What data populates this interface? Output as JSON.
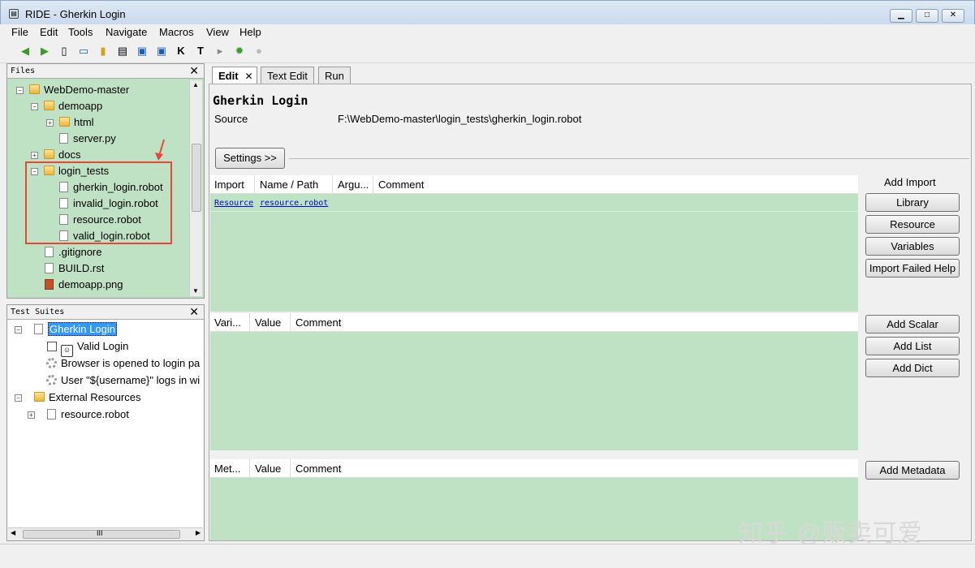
{
  "window": {
    "title": "RIDE - Gherkin Login",
    "icon": "ride-app-icon"
  },
  "menu": [
    "File",
    "Edit",
    "Tools",
    "Navigate",
    "Macros",
    "View",
    "Help"
  ],
  "files_panel": {
    "title": "Files",
    "tree": [
      {
        "label": "WebDemo-master",
        "type": "folder"
      },
      {
        "label": "demoapp",
        "type": "folder"
      },
      {
        "label": "html",
        "type": "folder"
      },
      {
        "label": "server.py",
        "type": "file"
      },
      {
        "label": "docs",
        "type": "folder"
      },
      {
        "label": "login_tests",
        "type": "folder"
      },
      {
        "label": "gherkin_login.robot",
        "type": "file"
      },
      {
        "label": "invalid_login.robot",
        "type": "file"
      },
      {
        "label": "resource.robot",
        "type": "file"
      },
      {
        "label": "valid_login.robot",
        "type": "file"
      },
      {
        "label": ".gitignore",
        "type": "file"
      },
      {
        "label": "BUILD.rst",
        "type": "file"
      },
      {
        "label": "demoapp.png",
        "type": "image"
      }
    ]
  },
  "suites_panel": {
    "title": "Test Suites",
    "items": [
      {
        "label": "Gherkin Login",
        "selected": true
      },
      {
        "label": "Valid Login"
      },
      {
        "label": "Browser is opened to login pa"
      },
      {
        "label": "User \"${username}\" logs in wi"
      },
      {
        "label": "External Resources"
      },
      {
        "label": "resource.robot"
      }
    ],
    "hscroll_mark": "III"
  },
  "tabs": [
    "Edit",
    "Text Edit",
    "Run"
  ],
  "editor": {
    "suite_title": "Gherkin Login",
    "source_label": "Source",
    "source_path": "F:\\WebDemo-master\\login_tests\\gherkin_login.robot",
    "settings_button": "Settings >>",
    "import_table": {
      "headers": [
        "Import",
        "Name / Path",
        "Argu...",
        "Comment"
      ],
      "rows": [
        [
          "Resource",
          "resource.robot",
          "",
          ""
        ]
      ]
    },
    "import_buttons": {
      "title": "Add Import",
      "library": "Library",
      "resource": "Resource",
      "variables": "Variables",
      "failed_help": "Import Failed Help"
    },
    "variable_table": {
      "headers": [
        "Vari...",
        "Value",
        "Comment"
      ]
    },
    "variable_buttons": {
      "scalar": "Add Scalar",
      "list": "Add List",
      "dict": "Add Dict"
    },
    "metadata_table": {
      "headers": [
        "Met...",
        "Value",
        "Comment"
      ]
    },
    "metadata_button": "Add Metadata"
  },
  "watermark": "知乎 @贩卖可爱",
  "colors": {
    "panel_green": "#c0e2c4",
    "highlight_box": "#e8463a",
    "selection_blue": "#3399ff"
  }
}
